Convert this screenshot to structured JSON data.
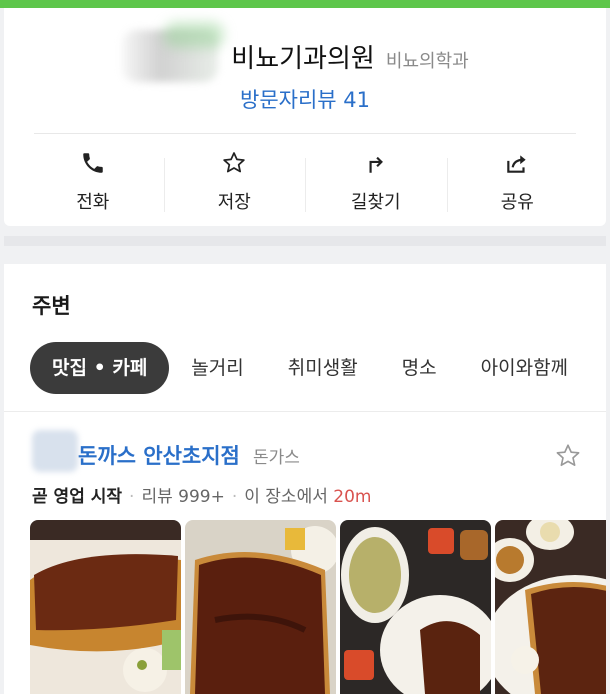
{
  "place": {
    "name_visible": "비뇨기과의원",
    "category": "비뇨의학과",
    "reviews_link": "방문자리뷰 41"
  },
  "actions": [
    {
      "label": "전화",
      "icon": "phone-icon"
    },
    {
      "label": "저장",
      "icon": "star-icon"
    },
    {
      "label": "길찾기",
      "icon": "directions-icon"
    },
    {
      "label": "공유",
      "icon": "share-icon"
    }
  ],
  "nearby": {
    "title": "주변",
    "chips": [
      "맛집 • 카페",
      "놀거리",
      "취미생활",
      "명소",
      "아이와함께"
    ],
    "active_chip": 0,
    "result": {
      "name": "돈까스 안산초지점",
      "category": "돈가스",
      "status": "곧 영업 시작",
      "reviews": "리뷰 999+",
      "distance_prefix": "이 장소에서",
      "distance": "20m"
    }
  },
  "colors": {
    "top_bar": "#5ec64b",
    "link_blue": "#2a6fc9",
    "distance_red": "#d9534f",
    "chip_active_bg": "#3b3b3b"
  }
}
